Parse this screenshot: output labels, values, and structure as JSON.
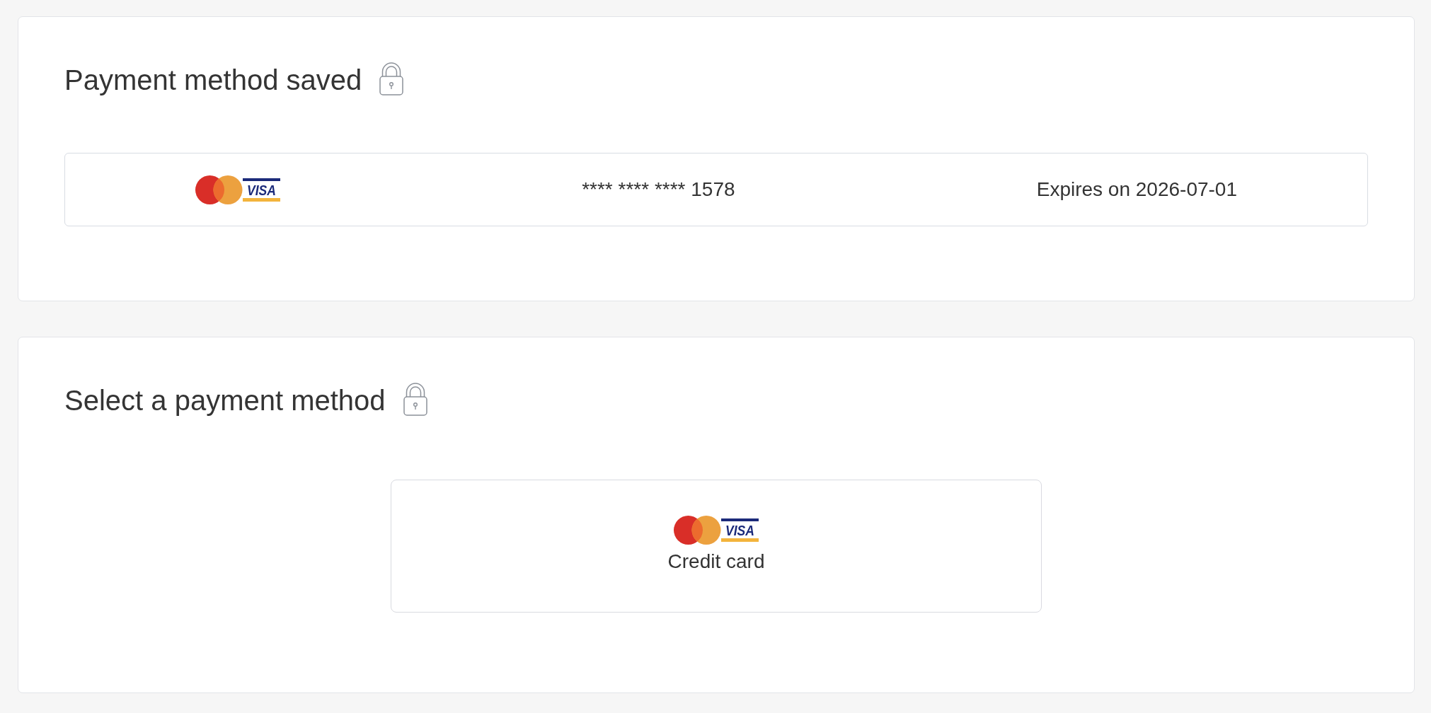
{
  "sections": [
    {
      "kind": "saved",
      "title": "Payment method saved",
      "saved_card": {
        "logo_text": "VISA",
        "number": "**** **** **** 1578",
        "expiry": "Expires on 2026-07-01"
      }
    },
    {
      "kind": "select",
      "title": "Select a payment method",
      "options": [
        {
          "logo_text": "VISA",
          "label": "Credit card",
          "selected": false
        }
      ]
    }
  ]
}
